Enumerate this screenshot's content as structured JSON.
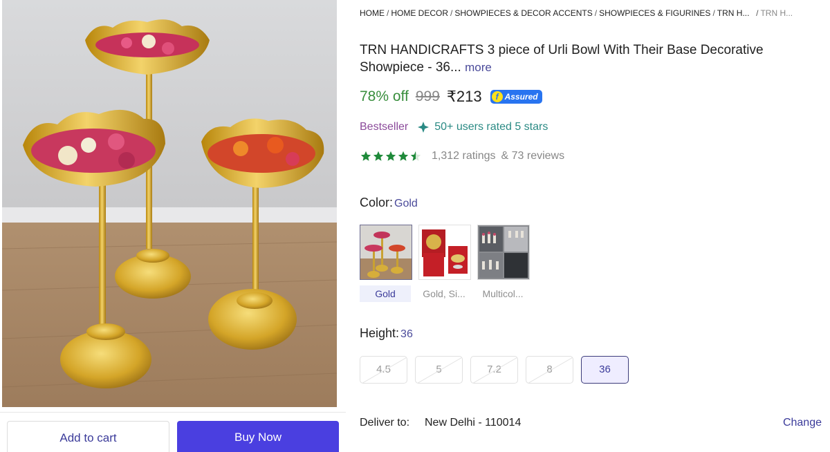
{
  "breadcrumb": {
    "items": [
      "HOME",
      "HOME DECOR",
      "SHOWPIECES & DECOR ACCENTS",
      "SHOWPIECES & FIGURINES",
      "TRN H..."
    ],
    "last": "TRN H..."
  },
  "product": {
    "title": "TRN HANDICRAFTS 3 piece of Urli Bowl With Their Base Decorative Showpiece  -  36...",
    "more_label": "more",
    "discount": "78% off",
    "mrp": "999",
    "price": "₹213",
    "assured_label": "Assured",
    "bestseller_label": "Bestseller",
    "rated_text": "50+ users rated 5 stars",
    "ratings_text": "1,312 ratings",
    "reviews_text": "& 73 reviews",
    "star_rating": 4.5
  },
  "color": {
    "label": "Color:",
    "selected": "Gold",
    "options": [
      {
        "caption": "Gold",
        "selected": true
      },
      {
        "caption": "Gold, Si...",
        "selected": false
      },
      {
        "caption": "Multicol...",
        "selected": false
      }
    ]
  },
  "height": {
    "label": "Height:",
    "selected": "36",
    "options": [
      {
        "value": "4.5",
        "selected": false
      },
      {
        "value": "5",
        "selected": false
      },
      {
        "value": "7.2",
        "selected": false
      },
      {
        "value": "8",
        "selected": false
      },
      {
        "value": "36",
        "selected": true
      }
    ]
  },
  "delivery": {
    "label": "Deliver to:",
    "location": "New Delhi - 110014",
    "change_label": "Change"
  },
  "actions": {
    "add_to_cart": "Add to cart",
    "buy_now": "Buy Now"
  },
  "colors": {
    "discount_green": "#388e3c",
    "assured_blue": "#2874f0",
    "buy_button": "#4a3fe0",
    "accent_purple": "#3b3b9a",
    "rated_teal": "#2a8a84",
    "star_green": "#1f8a3a"
  }
}
